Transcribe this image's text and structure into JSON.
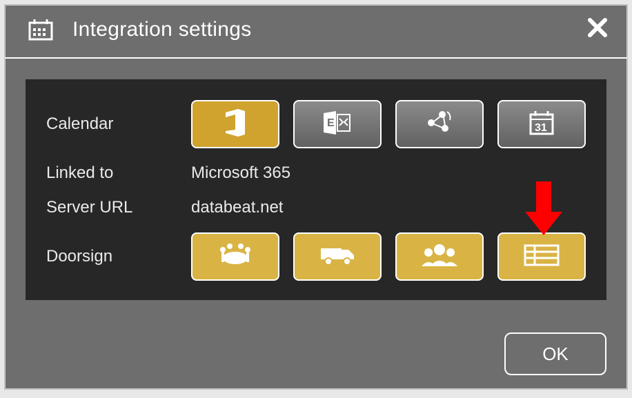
{
  "title": "Integration settings",
  "labels": {
    "calendar": "Calendar",
    "linked_to": "Linked to",
    "server_url": "Server URL",
    "doorsign": "Doorsign"
  },
  "values": {
    "linked_to": "Microsoft 365",
    "server_url": "databeat.net"
  },
  "calendar_options": [
    {
      "name": "office-365",
      "selected": true
    },
    {
      "name": "exchange",
      "selected": false
    },
    {
      "name": "sharepoint",
      "selected": false
    },
    {
      "name": "calendar-31",
      "selected": false
    }
  ],
  "doorsign_options": [
    {
      "name": "meeting-room"
    },
    {
      "name": "delivery-van"
    },
    {
      "name": "people-group"
    },
    {
      "name": "channel-list"
    }
  ],
  "ok_label": "OK",
  "colors": {
    "accent_gold": "#d0a32e",
    "panel_dark": "#272727",
    "dialog_grey": "#6e6e6e",
    "arrow_red": "#ff0000"
  }
}
